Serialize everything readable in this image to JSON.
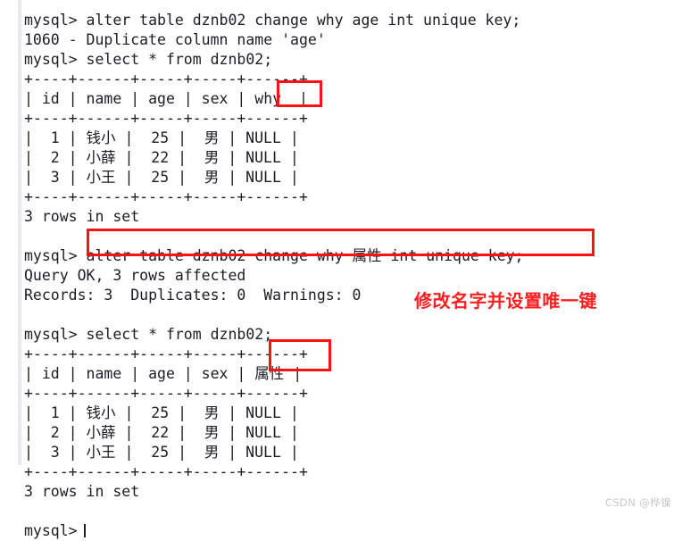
{
  "console": {
    "lines": [
      "mysql> alter table dznb02 change why age int unique key;",
      "1060 - Duplicate column name 'age'",
      "mysql> select * from dznb02;",
      "+----+------+-----+-----+------+",
      "| id | name | age | sex | why  |",
      "+----+------+-----+-----+------+",
      "|  1 | 钱小 |  25 |  男 | NULL |",
      "|  2 | 小薛 |  22 |  男 | NULL |",
      "|  3 | 小王 |  25 |  男 | NULL |",
      "+----+------+-----+-----+------+",
      "3 rows in set",
      "",
      "mysql> alter table dznb02 change why 属性 int unique key;",
      "Query OK, 3 rows affected",
      "Records: 3  Duplicates: 0  Warnings: 0",
      "",
      "mysql> select * from dznb02;",
      "+----+------+-----+-----+------+",
      "| id | name | age | sex | 属性 |",
      "+----+------+-----+-----+------+",
      "|  1 | 钱小 |  25 |  男 | NULL |",
      "|  2 | 小薛 |  22 |  男 | NULL |",
      "|  3 | 小王 |  25 |  男 | NULL |",
      "+----+------+-----+-----+------+",
      "3 rows in set",
      "",
      "mysql>"
    ]
  },
  "annotations": {
    "highlight_why": "why",
    "highlight_alter_statement": "alter table dznb02 change why 属性 int unique key;",
    "highlight_shuxing": "属性",
    "note_text": "修改名字并设置唯一键",
    "color": "#fb1313",
    "note_color": "#fb2020"
  },
  "watermark": {
    "text": "CSDN @桦镍"
  }
}
